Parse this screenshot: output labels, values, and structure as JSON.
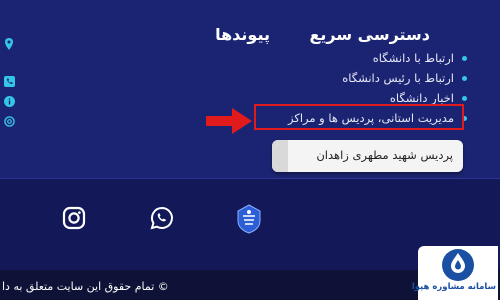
{
  "headings": {
    "quick_access": "دسترسی سریع",
    "links": "پیوندها"
  },
  "quick_access_items": [
    "ارتباط با دانشگاه",
    "ارتباط با رئیس دانشگاه",
    "اخبار دانشگاه",
    "مدیریت استانی، پردیس ها و مراکز"
  ],
  "dropdown": {
    "selected": "پردیس شهید مطهری زاهدان"
  },
  "footer": {
    "copyright": "© تمام حقوق این سایت متعلق به دا"
  },
  "brand": {
    "text": "سامانه مشاوره هپوا"
  },
  "colors": {
    "background": "#1b2472",
    "bullet": "#35c6e5",
    "highlight": "#e11b1b"
  },
  "icons": [
    "location-pin-icon",
    "phone-icon",
    "info-icon",
    "email-icon",
    "instagram-icon",
    "whatsapp-icon",
    "university-logo-icon",
    "brand-logo-icon",
    "arrow-right-icon"
  ]
}
